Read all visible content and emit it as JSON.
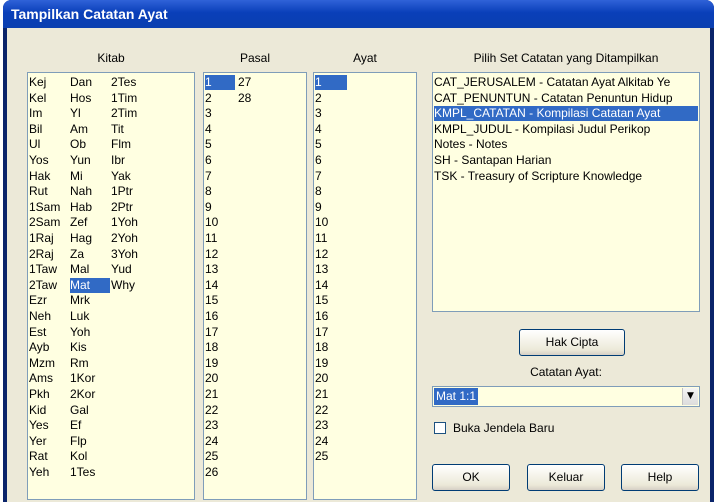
{
  "window": {
    "title": "Tampilkan Catatan Ayat"
  },
  "headers": {
    "kitab": "Kitab",
    "pasal": "Pasal",
    "ayat": "Ayat",
    "set": "Pilih Set Catatan yang Ditampilkan"
  },
  "kitab": {
    "col1": [
      "Kej",
      "Kel",
      "Im",
      "Bil",
      "Ul",
      "Yos",
      "Hak",
      "Rut",
      "1Sam",
      "2Sam",
      "1Raj",
      "2Raj",
      "1Taw",
      "2Taw",
      "Ezr",
      "Neh",
      "Est",
      "Ayb",
      "Mzm",
      "Ams",
      "Pkh",
      "Kid",
      "Yes",
      "Yer",
      "Rat",
      "Yeh"
    ],
    "col2": [
      "Dan",
      "Hos",
      "Yl",
      "Am",
      "Ob",
      "Yun",
      "Mi",
      "Nah",
      "Hab",
      "Zef",
      "Hag",
      "Za",
      "Mal",
      "Mat",
      "Mrk",
      "Luk",
      "Yoh",
      "Kis",
      "Rm",
      "1Kor",
      "2Kor",
      "Gal",
      "Ef",
      "Flp",
      "Kol",
      "1Tes"
    ],
    "col3": [
      "2Tes",
      "1Tim",
      "2Tim",
      "Tit",
      "Flm",
      "Ibr",
      "Yak",
      "1Ptr",
      "2Ptr",
      "1Yoh",
      "2Yoh",
      "3Yoh",
      "Yud",
      "Why"
    ],
    "selected": "Mat"
  },
  "pasal": {
    "col1": [
      "1",
      "2",
      "3",
      "4",
      "5",
      "6",
      "7",
      "8",
      "9",
      "10",
      "11",
      "12",
      "13",
      "14",
      "15",
      "16",
      "17",
      "18",
      "19",
      "20",
      "21",
      "22",
      "23",
      "24",
      "25",
      "26"
    ],
    "col2": [
      "27",
      "28"
    ],
    "selected": "1"
  },
  "ayat": {
    "items": [
      "1",
      "2",
      "3",
      "4",
      "5",
      "6",
      "7",
      "8",
      "9",
      "10",
      "11",
      "12",
      "13",
      "14",
      "15",
      "16",
      "17",
      "18",
      "19",
      "20",
      "21",
      "22",
      "23",
      "24",
      "25"
    ],
    "selected": "1"
  },
  "sets": {
    "items": [
      "CAT_JERUSALEM - Catatan Ayat Alkitab Ye",
      "CAT_PENUNTUN - Catatan Penuntun Hidup",
      "KMPL_CATATAN - Kompilasi Catatan Ayat",
      "KMPL_JUDUL - Kompilasi Judul Perikop",
      "Notes - Notes",
      "SH - Santapan Harian",
      "TSK - Treasury of Scripture Knowledge"
    ],
    "selected_index": 2
  },
  "buttons": {
    "hak_cipta": "Hak Cipta",
    "ok": "OK",
    "keluar": "Keluar",
    "help": "Help"
  },
  "catatan_ayat": {
    "label": "Catatan Ayat:",
    "value": "Mat 1:1"
  },
  "buka_jendela": {
    "label": "Buka Jendela Baru",
    "checked": false
  },
  "colors": {
    "title_bar": "#0a3fb9",
    "list_bg": "#ffffe1",
    "selection": "#316ac5",
    "dialog_bg": "#ece9d8"
  }
}
